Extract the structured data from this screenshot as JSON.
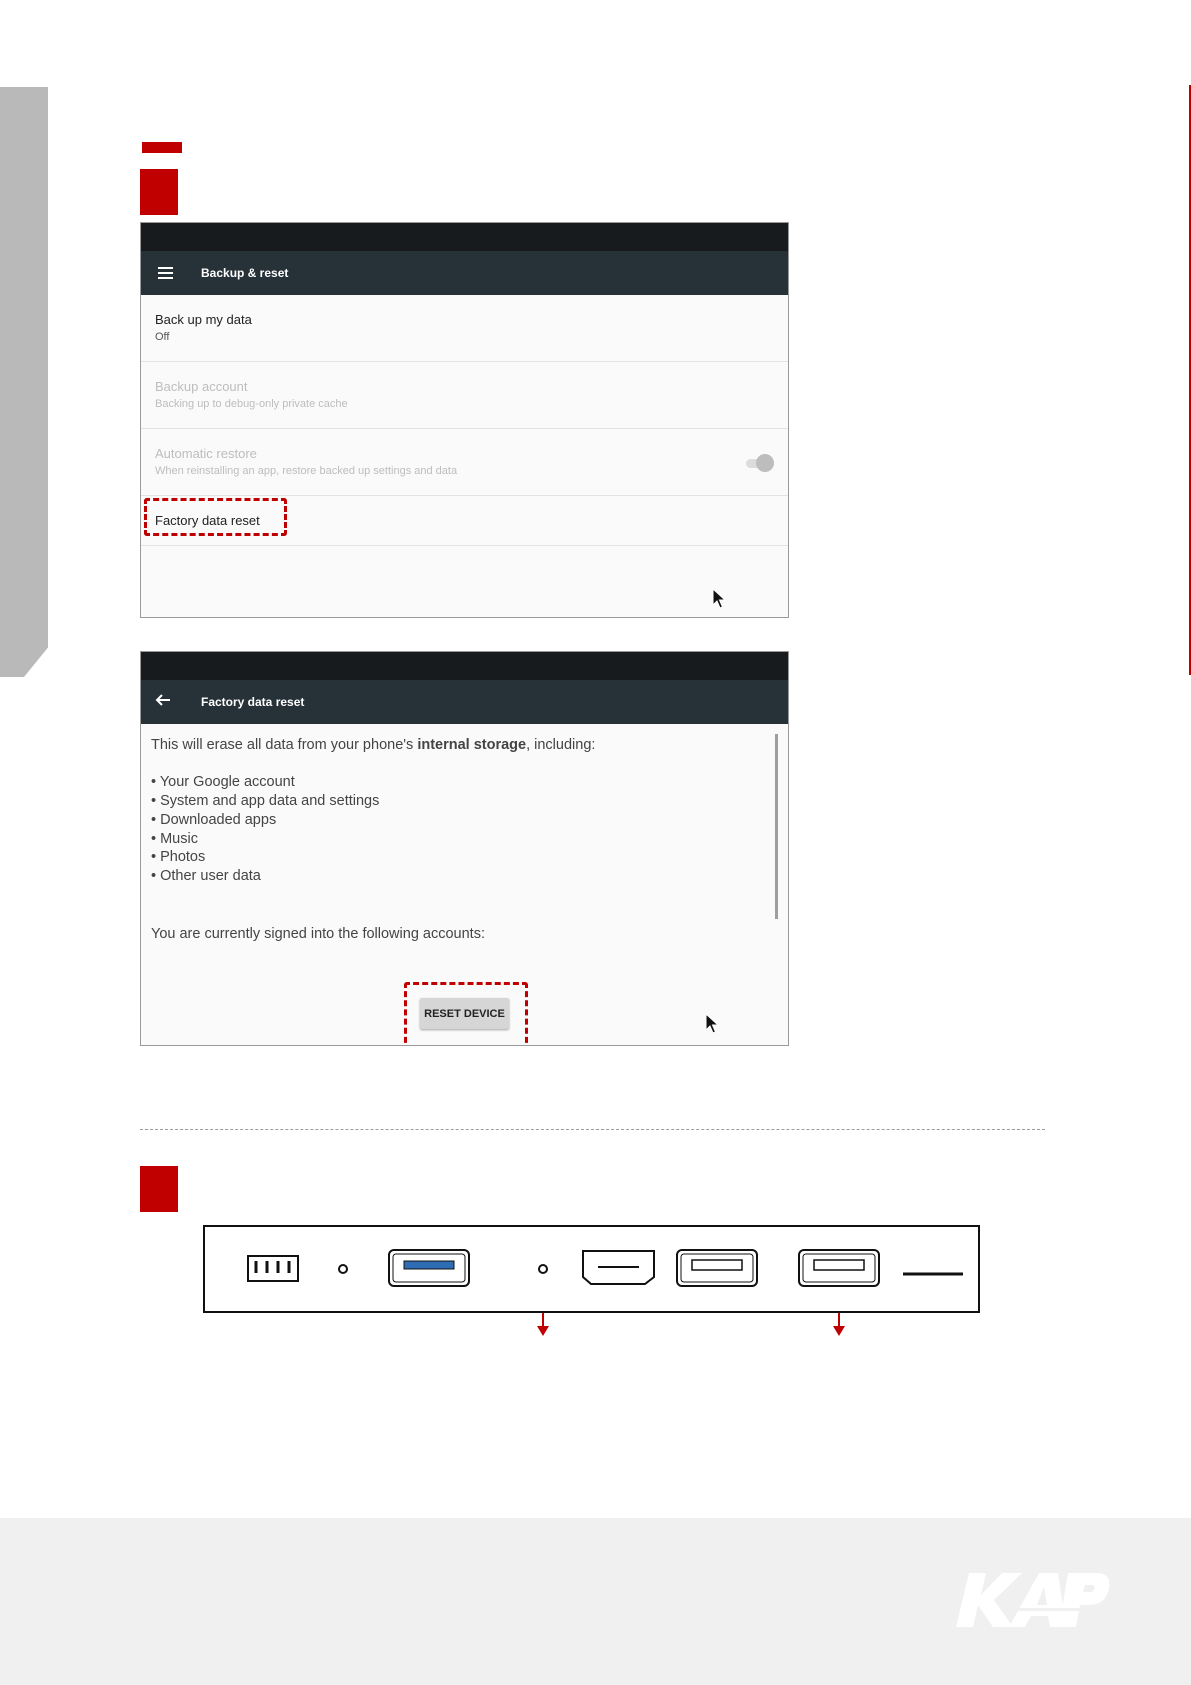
{
  "screen1": {
    "title": "Backup & reset",
    "rows": [
      {
        "title": "Back up my data",
        "subtitle": "Off"
      },
      {
        "title": "Backup account",
        "subtitle": "Backing up to debug-only private cache"
      },
      {
        "title": "Automatic restore",
        "subtitle": "When reinstalling an app, restore backed up settings and data"
      },
      {
        "title": "Factory data reset"
      }
    ]
  },
  "screen2": {
    "title": "Factory data reset",
    "intro_before": "This will erase all data from your phone's ",
    "intro_bold": "internal storage",
    "intro_after": ", including:",
    "items": [
      "• Your Google account",
      "• System and app data and settings",
      "• Downloaded apps",
      "• Music",
      "• Photos",
      "• Other user data"
    ],
    "accounts_text": "You are currently signed into the following accounts:",
    "reset_button": "RESET DEVICE"
  },
  "colors": {
    "accent": "#c00000",
    "app_bar": "#263238",
    "status_bar": "#181b1e",
    "usb3_blue": "#2e6db4"
  }
}
